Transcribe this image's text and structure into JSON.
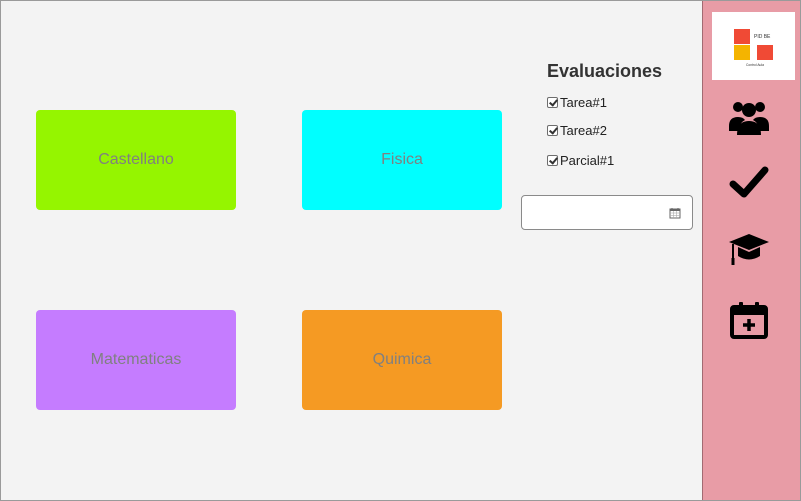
{
  "colors": {
    "background": "#f3f3f3",
    "sidebar": "#e89ca6",
    "card_text": "#808080"
  },
  "cards": [
    {
      "label": "Castellano",
      "color": "#95f500"
    },
    {
      "label": "Fisica",
      "color": "#00ffff"
    },
    {
      "label": "Matematicas",
      "color": "#c57cff"
    },
    {
      "label": "Quimica",
      "color": "#f59a23"
    }
  ],
  "evaluaciones": {
    "title": "Evaluaciones",
    "items": [
      {
        "label": "Tarea#1",
        "checked": true
      },
      {
        "label": "Tarea#2",
        "checked": true
      },
      {
        "label": "Parcial#1",
        "checked": true
      }
    ]
  },
  "date_picker": {
    "value": "",
    "icon": "calendar-icon"
  },
  "sidebar": {
    "logo": {
      "top_text": "PID BE",
      "bottom_text": "Control Aula"
    },
    "icons": [
      "users-icon",
      "check-icon",
      "graduation-cap-icon",
      "calendar-plus-icon"
    ]
  }
}
